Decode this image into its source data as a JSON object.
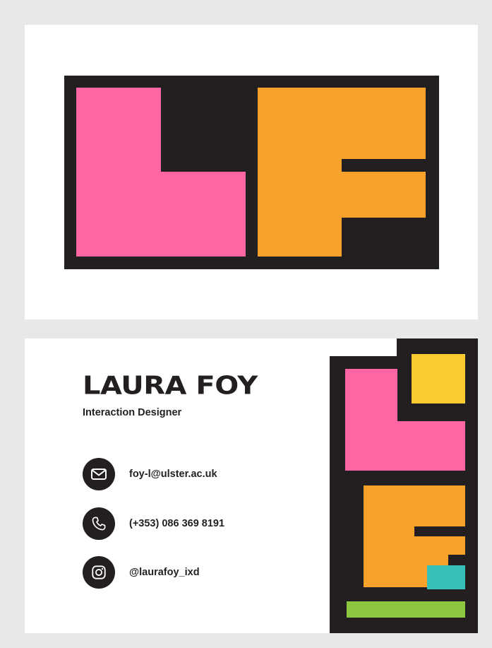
{
  "front": {
    "logo_letters": [
      "L",
      "F"
    ],
    "colors": {
      "background": "#231f20",
      "pink": "#ff66a3",
      "orange": "#f9a22b"
    }
  },
  "back": {
    "name": "LAURA FOY",
    "role": "Interaction Designer",
    "contacts": [
      {
        "icon": "mail-icon",
        "text": "foy-l@ulster.ac.uk"
      },
      {
        "icon": "phone-icon",
        "text": "(+353) 086 369 8191"
      },
      {
        "icon": "instagram-icon",
        "text": "@laurafoy_ixd"
      }
    ],
    "colors": {
      "dark": "#231f20",
      "pink": "#ff66a3",
      "orange": "#f9a22b",
      "yellow": "#fccb30",
      "teal": "#35c0b8",
      "green": "#8dc63f"
    }
  }
}
